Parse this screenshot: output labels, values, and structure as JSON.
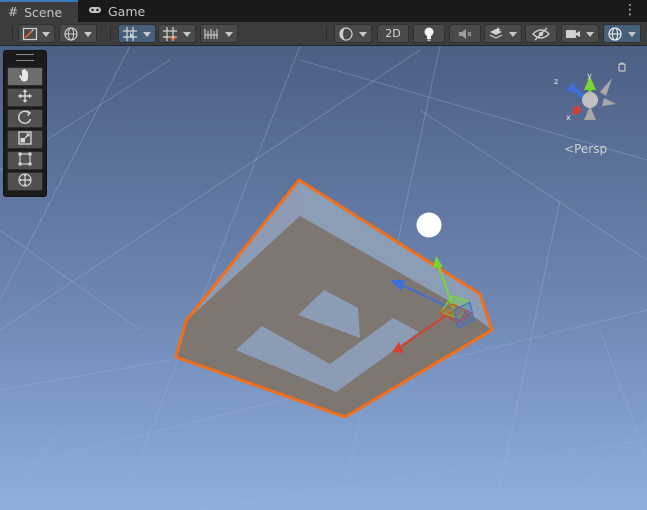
{
  "tabs": [
    {
      "label": "Scene",
      "icon": "grid-hash-icon",
      "active": true
    },
    {
      "label": "Game",
      "icon": "gamepad-icon",
      "active": false
    }
  ],
  "toolbar": {
    "draw_mode_icon": "draw-mode-icon",
    "global_icon": "globe-icon",
    "grid_snap_icon": "grid-snap-icon",
    "increment_snap_icon": "increment-snap-icon",
    "shading_icon": "shading-sphere-icon",
    "mode_2d_label": "2D",
    "lighting_icon": "lightbulb-icon",
    "audio_icon": "audio-mute-icon",
    "effects_icon": "effects-layers-icon",
    "visibility_icon": "hidden-eye-icon",
    "camera_icon": "camera-icon",
    "gizmos_icon": "gizmos-globe-icon"
  },
  "tools": [
    "hand-tool",
    "move-tool",
    "rotate-tool",
    "scale-tool",
    "rect-tool",
    "transform-tool"
  ],
  "active_tool": "hand-tool",
  "orientation_gizmo": {
    "projection_label": "Persp",
    "axes": [
      "y",
      "x",
      "z"
    ]
  },
  "colors": {
    "selection_outline": "#f26e1a",
    "axis_x": "#d6402f",
    "axis_y": "#79d632",
    "axis_z": "#3c6fd8",
    "sky_top": "#4c5f85",
    "sky_bottom": "#8fb0dc",
    "toolbar": "#3c3c3c"
  }
}
